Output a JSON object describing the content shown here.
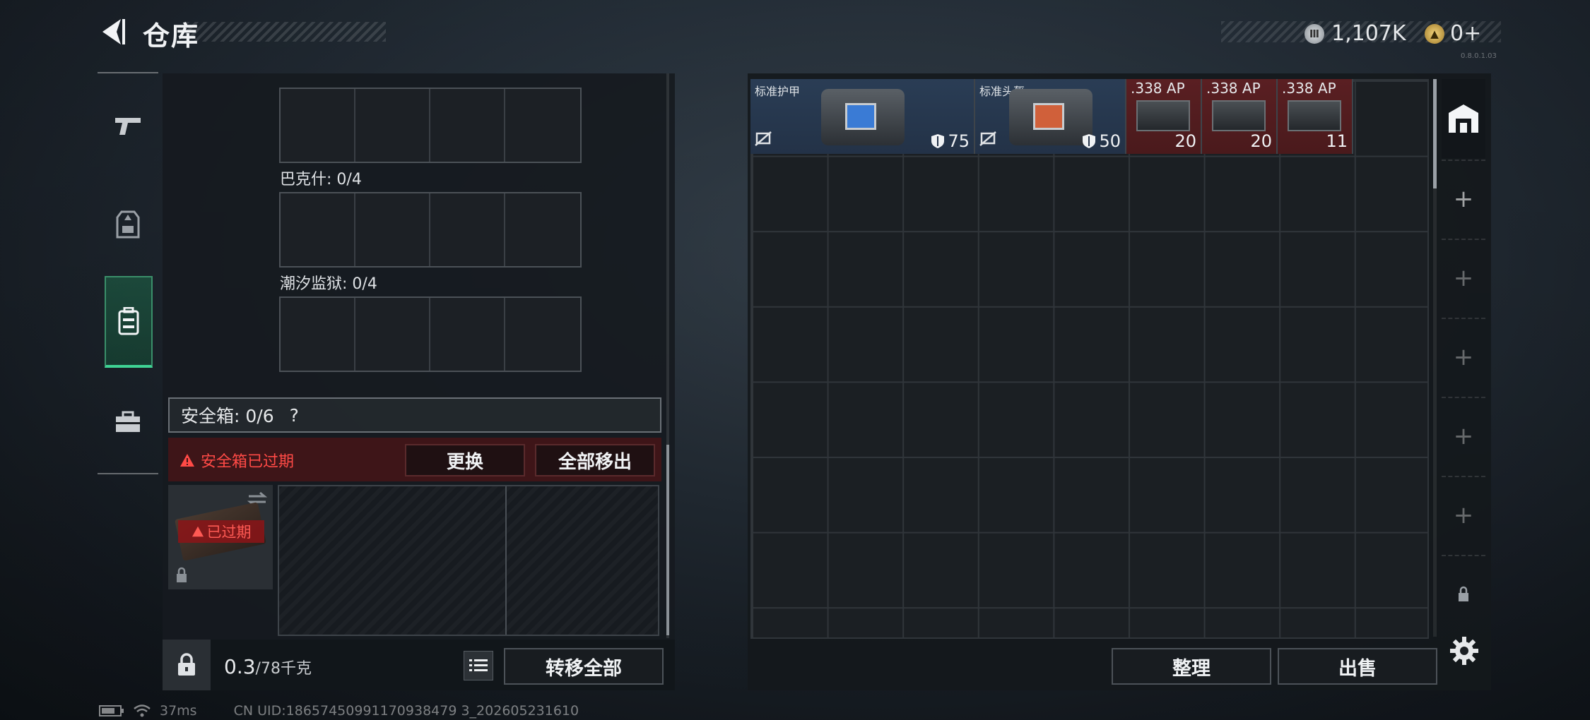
{
  "header": {
    "title": "仓库",
    "currency_silver": "1,107K",
    "currency_gold": "0+",
    "version": "0.8.0.1.03"
  },
  "left_panel": {
    "sections": [
      {
        "label": "巴克什: 0/4"
      },
      {
        "label": "潮汐监狱: 0/4"
      }
    ],
    "safe_box": {
      "label": "安全箱: 0/6",
      "help": "?",
      "warning": "安全箱已过期",
      "replace_label": "更换",
      "remove_all_label": "全部移出",
      "expired_tag": "已过期"
    },
    "weight": {
      "current": "0.3",
      "max": "/78千克"
    },
    "transfer_all_label": "转移全部"
  },
  "inventory": {
    "items": [
      {
        "name": "标准护甲",
        "value": "75",
        "type": "armor"
      },
      {
        "name": "标准头盔",
        "value": "50",
        "type": "helmet"
      },
      {
        "name": ".338 AP",
        "value": "20",
        "type": "ammo"
      },
      {
        "name": ".338 AP",
        "value": "20",
        "type": "ammo"
      },
      {
        "name": ".338 AP",
        "value": "11",
        "type": "ammo"
      }
    ],
    "sort_label": "整理",
    "sell_label": "出售"
  },
  "status_bar": {
    "ping": "37ms",
    "uid": "CN UID:18657450991170938479 3_202605231610"
  },
  "colors": {
    "accent_green": "#3fd394",
    "warning_red": "#ff4a46",
    "rare_blue": "#2a3d55",
    "rare_red": "#5a1f22"
  },
  "icons": [
    "back-arrow-icon",
    "pistol-icon",
    "armor-vest-icon",
    "backpack-icon",
    "toolbox-icon",
    "lock-icon",
    "list-icon",
    "shield-icon",
    "no-insure-icon",
    "stash-icon",
    "plus-icon",
    "gear-icon",
    "battery-icon",
    "wifi-icon",
    "warning-icon",
    "swap-icon"
  ]
}
